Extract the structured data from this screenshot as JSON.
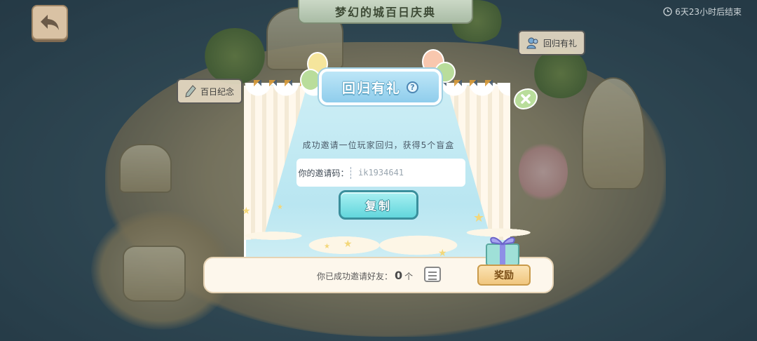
{
  "header": {
    "back_icon": "back-arrow-icon",
    "event_title": "梦幻的城百日庆典",
    "timer": "6天23小时后结束",
    "timer_icon": "clock-icon"
  },
  "side_buttons": {
    "hundred_days": "百日纪念",
    "return_gift": "回归有礼"
  },
  "modal": {
    "title": "回归有礼",
    "help_icon": "?",
    "close_icon": "close-icon",
    "description": "成功邀请一位玩家回归，获得5个盲盒",
    "code_label": "你的邀请码：",
    "code_value": "ik1934641",
    "copy_button": "复制",
    "invited_prefix": "你已成功邀请好友：",
    "invited_count": "0",
    "invited_suffix": "个",
    "reward_button": "奖励"
  },
  "colors": {
    "accent": "#62d6dc",
    "reward": "#f0c67e",
    "panel": "#fdf7ec"
  }
}
